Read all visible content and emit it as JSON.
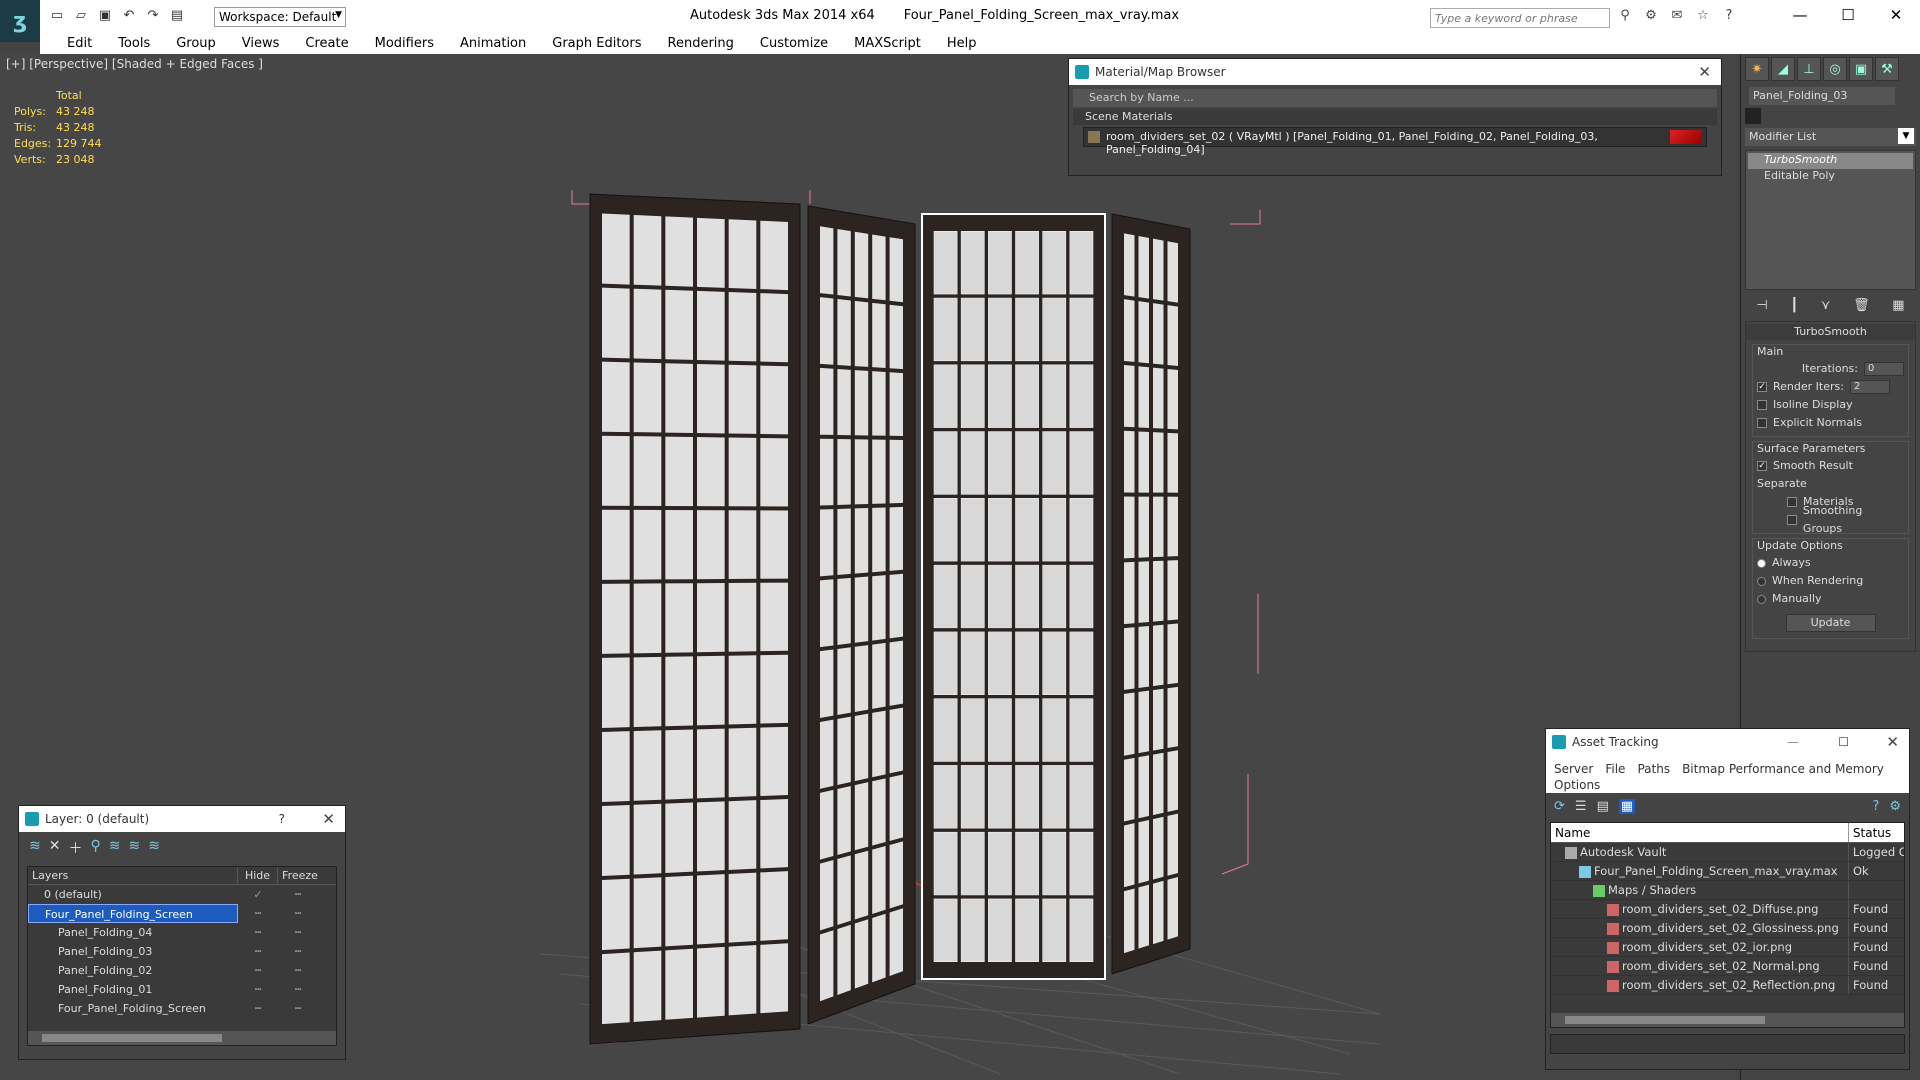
{
  "app": {
    "title": "Autodesk 3ds Max  2014 x64",
    "filename": "Four_Panel_Folding_Screen_max_vray.max",
    "workspace": "Workspace: Default",
    "search_placeholder": "Type a keyword or phrase"
  },
  "menu": [
    "Edit",
    "Tools",
    "Group",
    "Views",
    "Create",
    "Modifiers",
    "Animation",
    "Graph Editors",
    "Rendering",
    "Customize",
    "MAXScript",
    "Help"
  ],
  "viewport": {
    "label": "[+] [Perspective] [Shaded + Edged Faces ]",
    "stats": {
      "header": "Total",
      "rows": [
        {
          "k": "Polys:",
          "v": "43 248"
        },
        {
          "k": "Tris:",
          "v": "43 248"
        },
        {
          "k": "Edges:",
          "v": "129 744"
        },
        {
          "k": "Verts:",
          "v": "23 048"
        }
      ]
    }
  },
  "material_browser": {
    "title": "Material/Map Browser",
    "search": "Search by Name ...",
    "section": "Scene Materials",
    "material": "room_dividers_set_02  ( VRayMtl )  [Panel_Folding_01, Panel_Folding_02, Panel_Folding_03, Panel_Folding_04]"
  },
  "command_panel": {
    "object_name": "Panel_Folding_03",
    "modifier_list": "Modifier List",
    "stack": [
      "TurboSmooth",
      "Editable Poly"
    ],
    "rollout_title": "TurboSmooth",
    "main": "Main",
    "iterations_label": "Iterations:",
    "iterations": "0",
    "render_iters_label": "Render Iters:",
    "render_iters": "2",
    "isoline": "Isoline Display",
    "explicit": "Explicit Normals",
    "surface": "Surface Parameters",
    "smooth_result": "Smooth Result",
    "separate": "Separate",
    "materials": "Materials",
    "smoothing_groups": "Smoothing Groups",
    "update_options": "Update Options",
    "always": "Always",
    "when_rendering": "When Rendering",
    "manually": "Manually",
    "update": "Update"
  },
  "layers": {
    "title": "Layer: 0 (default)",
    "help": "?",
    "col_layers": "Layers",
    "col_hide": "Hide",
    "col_freeze": "Freeze",
    "rows": [
      {
        "name": "0 (default)",
        "indent": 0
      },
      {
        "name": "Four_Panel_Folding_Screen",
        "indent": 0
      },
      {
        "name": "Panel_Folding_04",
        "indent": 1
      },
      {
        "name": "Panel_Folding_03",
        "indent": 1
      },
      {
        "name": "Panel_Folding_02",
        "indent": 1
      },
      {
        "name": "Panel_Folding_01",
        "indent": 1
      },
      {
        "name": "Four_Panel_Folding_Screen",
        "indent": 1
      }
    ]
  },
  "asset": {
    "title": "Asset Tracking",
    "menu": [
      "Server",
      "File",
      "Paths",
      "Bitmap Performance and Memory",
      "Options"
    ],
    "col_name": "Name",
    "col_status": "Status",
    "rows": [
      {
        "name": "Autodesk Vault",
        "status": "Logged O",
        "indent": 1
      },
      {
        "name": "Four_Panel_Folding_Screen_max_vray.max",
        "status": "Ok",
        "indent": 2
      },
      {
        "name": "Maps / Shaders",
        "status": "",
        "indent": 3
      },
      {
        "name": "room_dividers_set_02_Diffuse.png",
        "status": "Found",
        "indent": 4
      },
      {
        "name": "room_dividers_set_02_Glossiness.png",
        "status": "Found",
        "indent": 4
      },
      {
        "name": "room_dividers_set_02_ior.png",
        "status": "Found",
        "indent": 4
      },
      {
        "name": "room_dividers_set_02_Normal.png",
        "status": "Found",
        "indent": 4
      },
      {
        "name": "room_dividers_set_02_Reflection.png",
        "status": "Found",
        "indent": 4
      }
    ]
  }
}
